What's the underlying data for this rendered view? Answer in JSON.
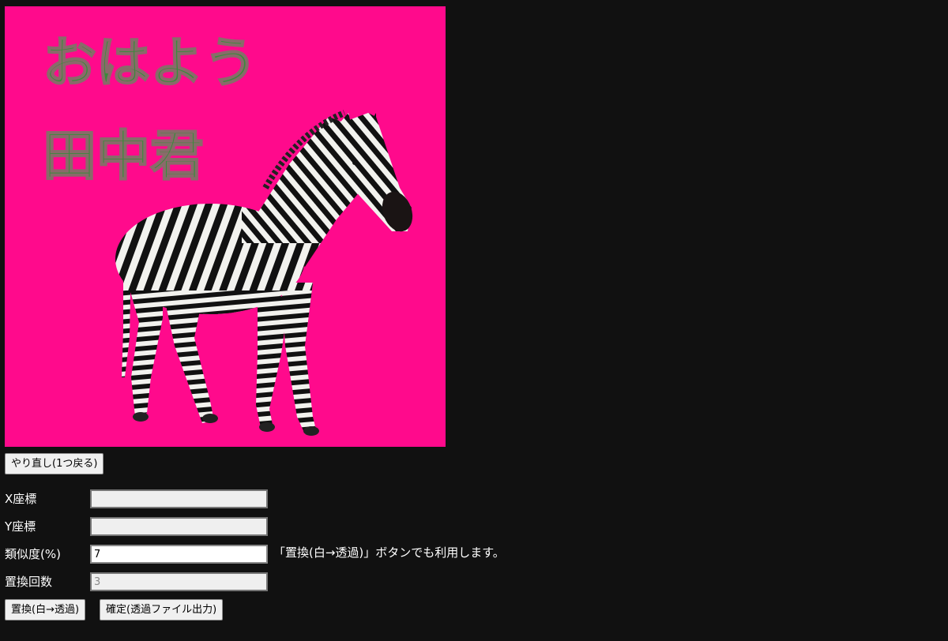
{
  "canvas": {
    "background": "#ff0a8c",
    "greeting_line1": "おはよう",
    "greeting_line2": "田中君",
    "text_color": "#3a8a3a",
    "subject": "zebra"
  },
  "buttons": {
    "undo": "やり直し(1つ戻る)",
    "replace": "置換(白→透過)",
    "confirm": "確定(透過ファイル出力)"
  },
  "form": {
    "x_label": "X座標",
    "x_value": "",
    "y_label": "Y座標",
    "y_value": "",
    "similarity_label": "類似度(%)",
    "similarity_value": "7",
    "similarity_note": "「置換(白→透過)」ボタンでも利用します。",
    "count_label": "置換回数",
    "count_value": "3"
  }
}
